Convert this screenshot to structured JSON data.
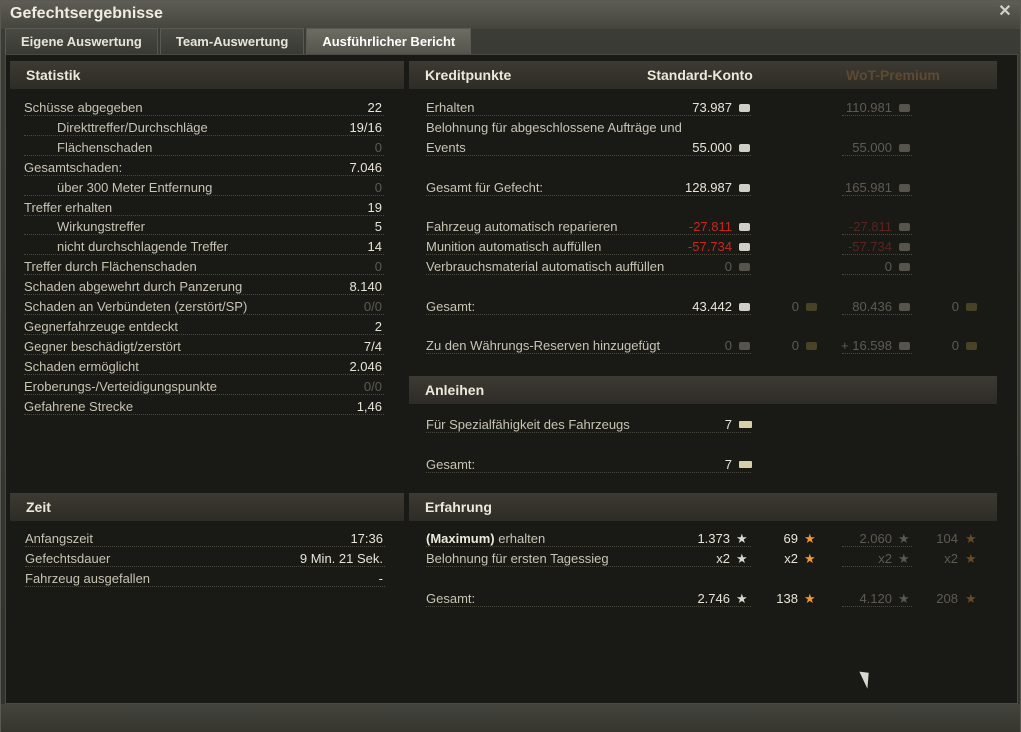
{
  "window": {
    "title": "Gefechtsergebnisse",
    "close_label": "✕"
  },
  "tabs": [
    {
      "label": "Eigene Auswertung"
    },
    {
      "label": "Team-Auswertung"
    },
    {
      "label": "Ausführlicher Bericht",
      "active": true
    }
  ],
  "statistik": {
    "title": "Statistik",
    "rows": [
      {
        "label": "Schüsse abgegeben",
        "value": "22"
      },
      {
        "label": "Direkttreffer/Durchschläge",
        "value": "19/16"
      },
      {
        "label": "Flächenschaden",
        "value": "0"
      },
      {
        "label": "Gesamtschaden:",
        "value": "7.046"
      },
      {
        "label": "über 300 Meter Entfernung",
        "value": "0"
      },
      {
        "label": "Treffer erhalten",
        "value": "19"
      },
      {
        "label": "Wirkungstreffer",
        "value": "5"
      },
      {
        "label": "nicht durchschlagende Treffer",
        "value": "14"
      },
      {
        "label": "Treffer durch Flächenschaden",
        "value": "0"
      },
      {
        "label": "Schaden abgewehrt durch Panzerung",
        "value": "8.140"
      },
      {
        "label": "Schaden an Verbündeten (zerstört/SP)",
        "value": "0/0"
      },
      {
        "label": "Gegnerfahrzeuge entdeckt",
        "value": "2"
      },
      {
        "label": "Gegner beschädigt/zerstört",
        "value": "7/4"
      },
      {
        "label": "Schaden ermöglicht",
        "value": "2.046"
      },
      {
        "label": "Eroberungs-/Verteidigungspunkte",
        "value": "0/0"
      },
      {
        "label": "Gefahrene Strecke",
        "value": "1,46"
      }
    ]
  },
  "zeit": {
    "title": "Zeit",
    "rows": [
      {
        "label": "Anfangszeit",
        "value": "17:36"
      },
      {
        "label": "Gefechtsdauer",
        "value": "9 Min. 21 Sek."
      },
      {
        "label": "Fahrzeug ausgefallen",
        "value": "-"
      }
    ]
  },
  "kredit": {
    "title": "Kreditpunkte",
    "standard_label": "Standard-Konto",
    "premium_label": "WoT-Premium",
    "rows": {
      "erhalten": {
        "label": "Erhalten",
        "std": "73.987",
        "prem": "110.981"
      },
      "belohnung": {
        "label": "Belohnung für abgeschlossene Aufträge und",
        "label2": "Events",
        "std": "55.000",
        "prem": "55.000"
      },
      "gesamt_gefecht": {
        "label": "Gesamt für Gefecht:",
        "std": "128.987",
        "prem": "165.981"
      },
      "reparieren": {
        "label": "Fahrzeug automatisch reparieren",
        "std": "-27.811",
        "prem": "-27.811"
      },
      "munition": {
        "label": "Munition automatisch auffüllen",
        "std": "-57.734",
        "prem": "-57.734"
      },
      "verbrauch": {
        "label": "Verbrauchsmaterial automatisch auffüllen",
        "std": "0",
        "prem": "0"
      },
      "gesamt": {
        "label": "Gesamt:",
        "std": "43.442",
        "std_gold": "0",
        "prem": "80.436",
        "prem_gold": "0"
      },
      "reserven": {
        "label": "Zu den Währungs-Reserven hinzugefügt",
        "std": "0",
        "std_gold": "0",
        "prem": "+ 16.598",
        "prem_gold": "0"
      }
    }
  },
  "anleihen": {
    "title": "Anleihen",
    "rows": [
      {
        "label": "Für Spezialfähigkeit des Fahrzeugs",
        "value": "7"
      },
      {
        "label": "Gesamt:",
        "value": "7"
      }
    ]
  },
  "erfahrung": {
    "title": "Erfahrung",
    "maximum_label": "(Maximum)",
    "erhalten_label": " erhalten",
    "rows": {
      "erhalten": {
        "std": "1.373",
        "std_free": "69",
        "prem": "2.060",
        "prem_free": "104"
      },
      "tagessieg": {
        "label": "Belohnung für ersten Tagessieg",
        "std": "x2",
        "std_free": "x2",
        "prem": "x2",
        "prem_free": "x2"
      },
      "gesamt": {
        "label": "Gesamt:",
        "std": "2.746",
        "std_free": "138",
        "prem": "4.120",
        "prem_free": "208"
      }
    }
  },
  "icons": {
    "credit": "credit-icon",
    "gold": "gold-icon",
    "bond": "bond-icon",
    "xp": "xp-star-icon",
    "free_xp": "free-xp-star-icon"
  },
  "colors": {
    "negative": "#c8281e",
    "gold": "#f09830"
  }
}
